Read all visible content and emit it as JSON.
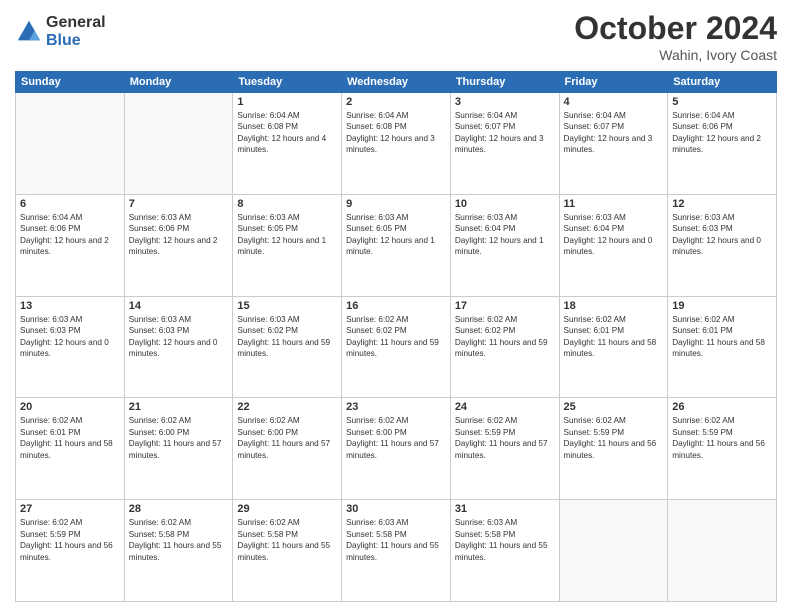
{
  "header": {
    "logo_line1": "General",
    "logo_line2": "Blue",
    "month": "October 2024",
    "location": "Wahin, Ivory Coast"
  },
  "days_of_week": [
    "Sunday",
    "Monday",
    "Tuesday",
    "Wednesday",
    "Thursday",
    "Friday",
    "Saturday"
  ],
  "weeks": [
    [
      {
        "day": "",
        "info": ""
      },
      {
        "day": "",
        "info": ""
      },
      {
        "day": "1",
        "info": "Sunrise: 6:04 AM\nSunset: 6:08 PM\nDaylight: 12 hours and 4 minutes."
      },
      {
        "day": "2",
        "info": "Sunrise: 6:04 AM\nSunset: 6:08 PM\nDaylight: 12 hours and 3 minutes."
      },
      {
        "day": "3",
        "info": "Sunrise: 6:04 AM\nSunset: 6:07 PM\nDaylight: 12 hours and 3 minutes."
      },
      {
        "day": "4",
        "info": "Sunrise: 6:04 AM\nSunset: 6:07 PM\nDaylight: 12 hours and 3 minutes."
      },
      {
        "day": "5",
        "info": "Sunrise: 6:04 AM\nSunset: 6:06 PM\nDaylight: 12 hours and 2 minutes."
      }
    ],
    [
      {
        "day": "6",
        "info": "Sunrise: 6:04 AM\nSunset: 6:06 PM\nDaylight: 12 hours and 2 minutes."
      },
      {
        "day": "7",
        "info": "Sunrise: 6:03 AM\nSunset: 6:06 PM\nDaylight: 12 hours and 2 minutes."
      },
      {
        "day": "8",
        "info": "Sunrise: 6:03 AM\nSunset: 6:05 PM\nDaylight: 12 hours and 1 minute."
      },
      {
        "day": "9",
        "info": "Sunrise: 6:03 AM\nSunset: 6:05 PM\nDaylight: 12 hours and 1 minute."
      },
      {
        "day": "10",
        "info": "Sunrise: 6:03 AM\nSunset: 6:04 PM\nDaylight: 12 hours and 1 minute."
      },
      {
        "day": "11",
        "info": "Sunrise: 6:03 AM\nSunset: 6:04 PM\nDaylight: 12 hours and 0 minutes."
      },
      {
        "day": "12",
        "info": "Sunrise: 6:03 AM\nSunset: 6:03 PM\nDaylight: 12 hours and 0 minutes."
      }
    ],
    [
      {
        "day": "13",
        "info": "Sunrise: 6:03 AM\nSunset: 6:03 PM\nDaylight: 12 hours and 0 minutes."
      },
      {
        "day": "14",
        "info": "Sunrise: 6:03 AM\nSunset: 6:03 PM\nDaylight: 12 hours and 0 minutes."
      },
      {
        "day": "15",
        "info": "Sunrise: 6:03 AM\nSunset: 6:02 PM\nDaylight: 11 hours and 59 minutes."
      },
      {
        "day": "16",
        "info": "Sunrise: 6:02 AM\nSunset: 6:02 PM\nDaylight: 11 hours and 59 minutes."
      },
      {
        "day": "17",
        "info": "Sunrise: 6:02 AM\nSunset: 6:02 PM\nDaylight: 11 hours and 59 minutes."
      },
      {
        "day": "18",
        "info": "Sunrise: 6:02 AM\nSunset: 6:01 PM\nDaylight: 11 hours and 58 minutes."
      },
      {
        "day": "19",
        "info": "Sunrise: 6:02 AM\nSunset: 6:01 PM\nDaylight: 11 hours and 58 minutes."
      }
    ],
    [
      {
        "day": "20",
        "info": "Sunrise: 6:02 AM\nSunset: 6:01 PM\nDaylight: 11 hours and 58 minutes."
      },
      {
        "day": "21",
        "info": "Sunrise: 6:02 AM\nSunset: 6:00 PM\nDaylight: 11 hours and 57 minutes."
      },
      {
        "day": "22",
        "info": "Sunrise: 6:02 AM\nSunset: 6:00 PM\nDaylight: 11 hours and 57 minutes."
      },
      {
        "day": "23",
        "info": "Sunrise: 6:02 AM\nSunset: 6:00 PM\nDaylight: 11 hours and 57 minutes."
      },
      {
        "day": "24",
        "info": "Sunrise: 6:02 AM\nSunset: 5:59 PM\nDaylight: 11 hours and 57 minutes."
      },
      {
        "day": "25",
        "info": "Sunrise: 6:02 AM\nSunset: 5:59 PM\nDaylight: 11 hours and 56 minutes."
      },
      {
        "day": "26",
        "info": "Sunrise: 6:02 AM\nSunset: 5:59 PM\nDaylight: 11 hours and 56 minutes."
      }
    ],
    [
      {
        "day": "27",
        "info": "Sunrise: 6:02 AM\nSunset: 5:59 PM\nDaylight: 11 hours and 56 minutes."
      },
      {
        "day": "28",
        "info": "Sunrise: 6:02 AM\nSunset: 5:58 PM\nDaylight: 11 hours and 55 minutes."
      },
      {
        "day": "29",
        "info": "Sunrise: 6:02 AM\nSunset: 5:58 PM\nDaylight: 11 hours and 55 minutes."
      },
      {
        "day": "30",
        "info": "Sunrise: 6:03 AM\nSunset: 5:58 PM\nDaylight: 11 hours and 55 minutes."
      },
      {
        "day": "31",
        "info": "Sunrise: 6:03 AM\nSunset: 5:58 PM\nDaylight: 11 hours and 55 minutes."
      },
      {
        "day": "",
        "info": ""
      },
      {
        "day": "",
        "info": ""
      }
    ]
  ]
}
